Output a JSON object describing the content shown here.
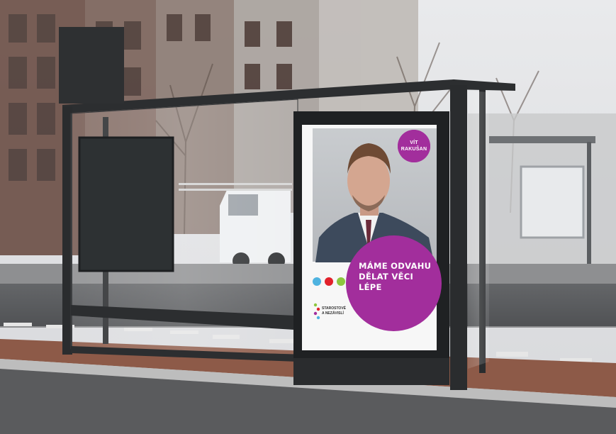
{
  "poster": {
    "badge_line1": "VÍT",
    "badge_line2": "RAKUŠAN",
    "slogan_line1": "MÁME ODVAHU",
    "slogan_line2": "DĚLAT VĚCI",
    "slogan_line3": "LÉPE",
    "party_line1": "STAROSTOVÉ",
    "party_line2": "A NEZÁVISLÍ"
  },
  "colors": {
    "brand_purple": "#a22e9c",
    "dot_blue": "#4fb3e0",
    "dot_red": "#e2212b",
    "dot_green": "#8dc63f"
  }
}
